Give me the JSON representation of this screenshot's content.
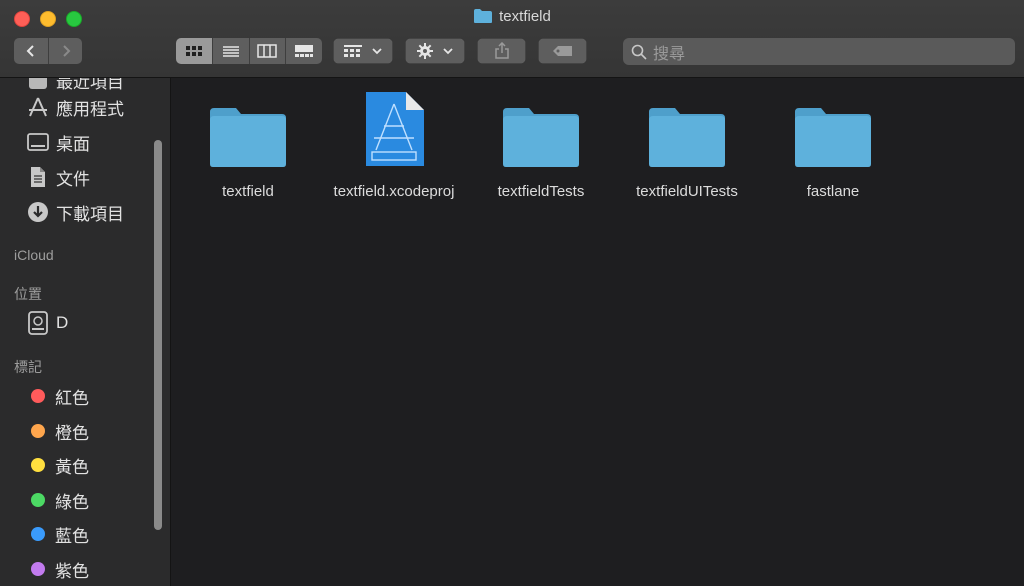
{
  "window": {
    "title": "textfield"
  },
  "toolbar": {
    "view_modes": [
      "icon-view",
      "list-view",
      "column-view",
      "gallery-view"
    ],
    "active_view": "icon-view",
    "search_placeholder": "搜尋"
  },
  "sidebar": {
    "partial_top_label": "最近項目",
    "favorites": [
      {
        "label": "應用程式",
        "icon": "applications-icon"
      },
      {
        "label": "桌面",
        "icon": "desktop-icon"
      },
      {
        "label": "文件",
        "icon": "documents-icon"
      },
      {
        "label": "下載項目",
        "icon": "downloads-icon"
      }
    ],
    "icloud_header": "iCloud",
    "locations_header": "位置",
    "locations": [
      {
        "label": "D",
        "icon": "disk-icon"
      }
    ],
    "tags_header": "標記",
    "tags": [
      {
        "label": "紅色",
        "color": "#ff5b5b"
      },
      {
        "label": "橙色",
        "color": "#ffa64d"
      },
      {
        "label": "黃色",
        "color": "#ffdf3f"
      },
      {
        "label": "綠色",
        "color": "#4cd964"
      },
      {
        "label": "藍色",
        "color": "#3a9bfc"
      },
      {
        "label": "紫色",
        "color": "#c27bef"
      }
    ]
  },
  "files": [
    {
      "name": "textfield",
      "type": "folder"
    },
    {
      "name": "textfield.xcodeproj",
      "type": "xcodeproj"
    },
    {
      "name": "textfieldTests",
      "type": "folder"
    },
    {
      "name": "textfieldUITests",
      "type": "folder"
    },
    {
      "name": "fastlane",
      "type": "folder"
    }
  ],
  "colors": {
    "folder": "#5eb1dc",
    "folder_tab": "#4e9fcb",
    "xcode_doc": "#2a8ae0"
  }
}
